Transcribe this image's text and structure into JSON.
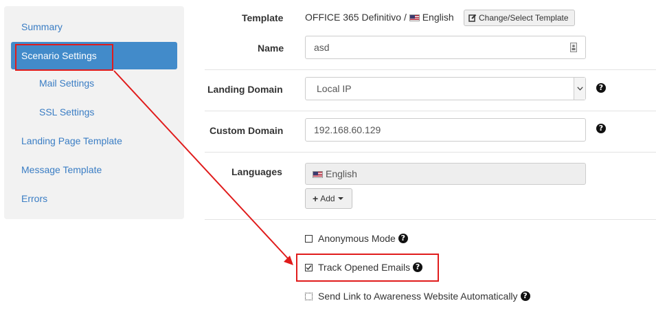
{
  "sidebar": {
    "items": [
      {
        "label": "Summary"
      },
      {
        "label": "Scenario Settings",
        "active": true
      },
      {
        "label": "Mail Settings",
        "sub": true
      },
      {
        "label": "SSL Settings",
        "sub": true
      },
      {
        "label": "Landing Page Template"
      },
      {
        "label": "Message Template"
      },
      {
        "label": "Errors"
      }
    ]
  },
  "form": {
    "template": {
      "label": "Template",
      "value": "OFFICE 365 Definitivo /",
      "language": "English",
      "button": "Change/Select Template"
    },
    "name": {
      "label": "Name",
      "value": "asd"
    },
    "landing_domain": {
      "label": "Landing Domain",
      "selected": "Local IP"
    },
    "custom_domain": {
      "label": "Custom Domain",
      "value": "192.168.60.129"
    },
    "languages": {
      "label": "Languages",
      "items": [
        "English"
      ],
      "add_button": "Add"
    },
    "options": [
      {
        "label": "Anonymous Mode",
        "checked": false
      },
      {
        "label": "Track Opened Emails",
        "checked": true
      },
      {
        "label": "Send Link to Awareness Website Automatically",
        "checked": false
      }
    ]
  },
  "colors": {
    "accent": "#428bca",
    "link": "#3a7dc4",
    "annotation": "#e01b1b"
  }
}
